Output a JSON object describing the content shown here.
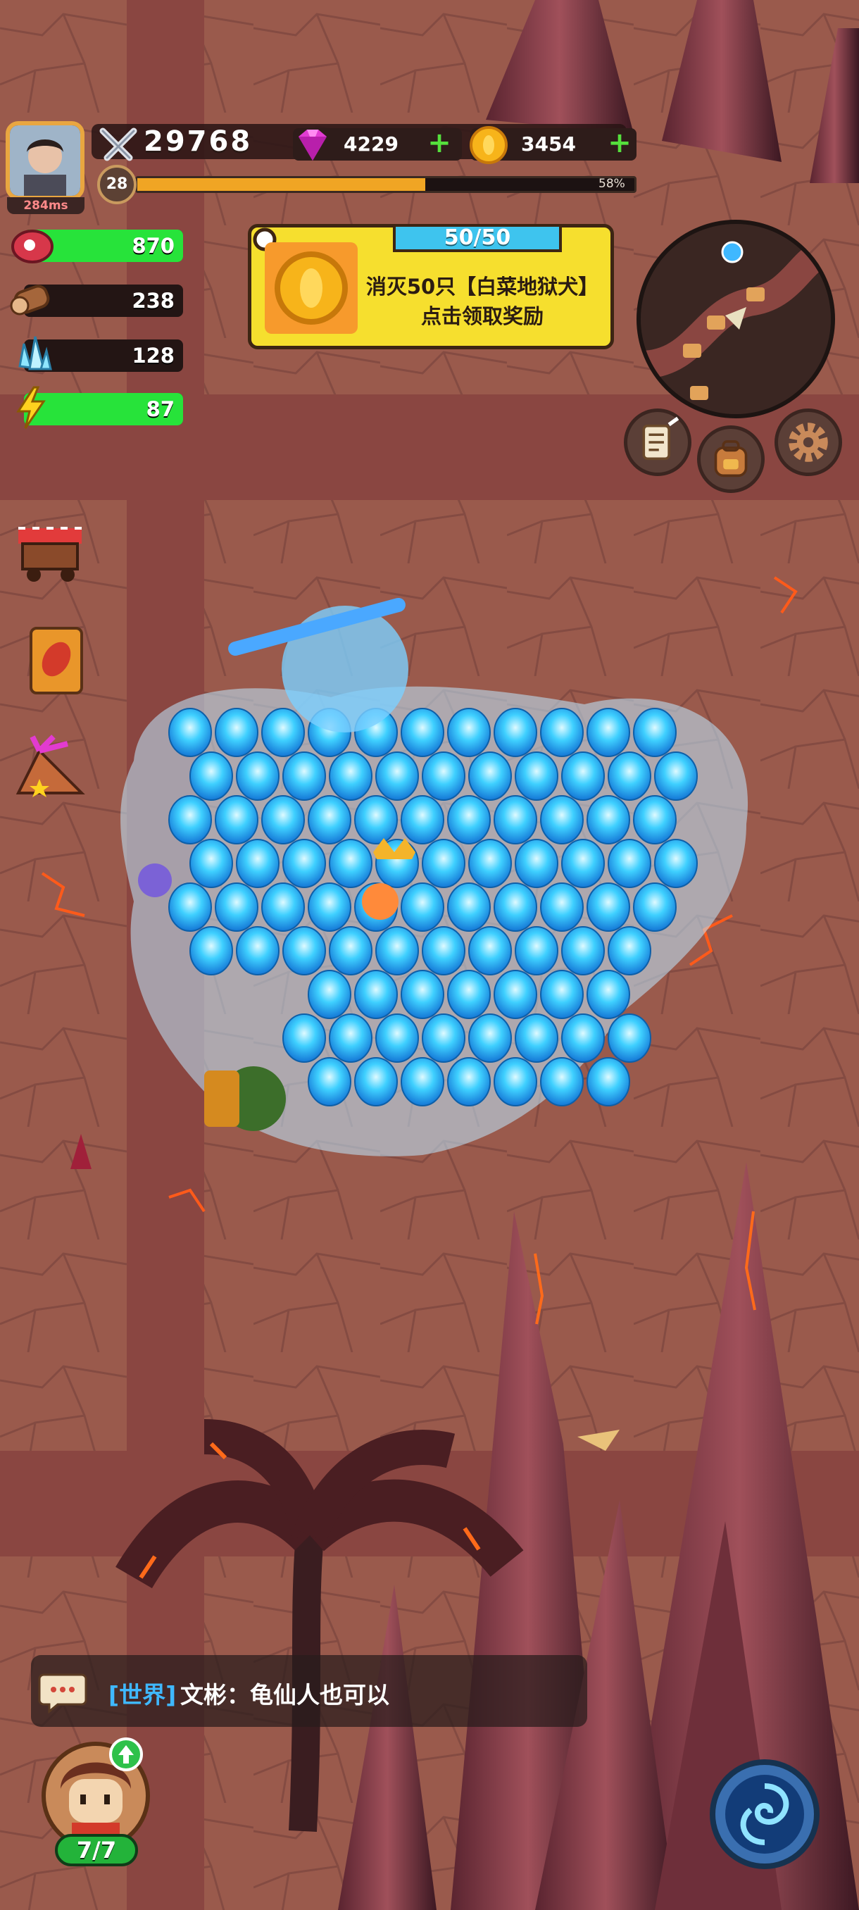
{
  "player": {
    "ping": "284ms",
    "power": "29768",
    "level": "28",
    "xp_percent_label": "58%",
    "xp_fraction": 0.58
  },
  "currency": {
    "gems": "4229",
    "gold": "3454"
  },
  "resources": [
    {
      "name": "meat",
      "value": "870",
      "fill": 1.0,
      "icon": "meat-icon"
    },
    {
      "name": "wood",
      "value": "238",
      "fill": 0.0,
      "icon": "wood-log-icon"
    },
    {
      "name": "crystal",
      "value": "128",
      "fill": 0.0,
      "icon": "crystal-icon"
    },
    {
      "name": "energy",
      "value": "87",
      "fill": 1.0,
      "icon": "lightning-icon"
    }
  ],
  "quest": {
    "progress": "50/50",
    "line1": "消灭50只【白菜地狱犬】",
    "line2": "点击领取奖励"
  },
  "chat": {
    "channel": "[世界]",
    "message": "文彬：龟仙人也可以"
  },
  "heroes": {
    "count": "7/7"
  },
  "colors": {
    "ground": "#9a5a4c",
    "path": "#8e4843",
    "quest_bg": "#f6df2e",
    "bar_green": "#27e33a",
    "xp_orange": "#f0a524",
    "ice_blue": "#3ec4ee"
  }
}
